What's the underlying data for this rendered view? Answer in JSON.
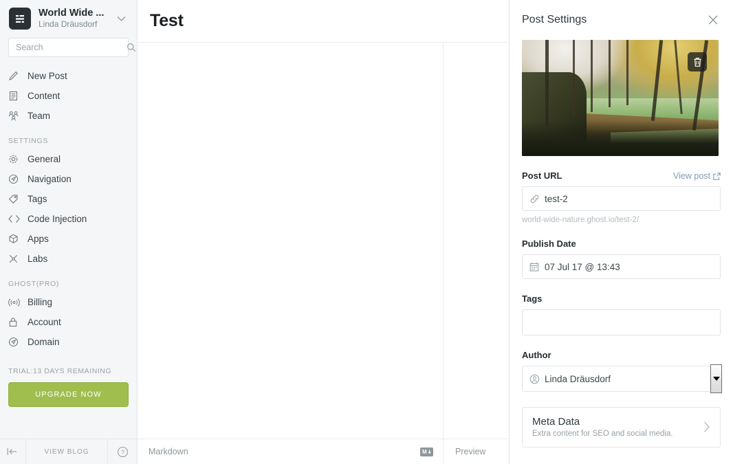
{
  "sidebar": {
    "brand": {
      "title": "World Wide ...",
      "subtitle": "Linda Dräusdorf",
      "logo_icon": "blog-list-icon",
      "caret_icon": "chevron-down-icon"
    },
    "search": {
      "placeholder": "Search",
      "value": "",
      "icon": "search-icon"
    },
    "primary_items": [
      {
        "label": "New Post",
        "icon": "pencil-icon"
      },
      {
        "label": "Content",
        "icon": "document-icon"
      },
      {
        "label": "Team",
        "icon": "people-icon"
      }
    ],
    "settings_heading": "SETTINGS",
    "settings_items": [
      {
        "label": "General",
        "icon": "gear-icon"
      },
      {
        "label": "Navigation",
        "icon": "compass-icon"
      },
      {
        "label": "Tags",
        "icon": "tag-icon"
      },
      {
        "label": "Code Injection",
        "icon": "code-icon"
      },
      {
        "label": "Apps",
        "icon": "box-icon"
      },
      {
        "label": "Labs",
        "icon": "labs-icon"
      }
    ],
    "ghostpro_heading": "GHOST(PRO)",
    "ghostpro_items": [
      {
        "label": "Billing",
        "icon": "broadcast-icon"
      },
      {
        "label": "Account",
        "icon": "lock-icon"
      },
      {
        "label": "Domain",
        "icon": "compass-icon"
      }
    ],
    "trial_text": "TRIAL:13 DAYS REMAINING",
    "upgrade_label": "UPGRADE NOW",
    "upgrade_color": "#9fbe4e",
    "footer": {
      "collapse_icon": "collapse-left-icon",
      "view_blog_label": "VIEW BLOG",
      "help_icon": "help-circle-icon"
    }
  },
  "editor": {
    "title": "Test",
    "markdown_label": "Markdown",
    "markdown_badge": "M",
    "preview_label": "Preview"
  },
  "panel": {
    "title": "Post Settings",
    "close_icon": "close-icon",
    "feature_image": {
      "alt": "Autumn swamp forest with green algae water",
      "delete_icon": "trash-icon"
    },
    "post_url": {
      "label": "Post URL",
      "view_post_label": "View post",
      "view_post_icon": "external-link-icon",
      "input_icon": "link-icon",
      "value": "test-2",
      "hint": "world-wide-nature.ghost.io/test-2/"
    },
    "publish_date": {
      "label": "Publish Date",
      "input_icon": "calendar-icon",
      "value": "07 Jul 17 @ 13:43"
    },
    "tags": {
      "label": "Tags",
      "value": "",
      "placeholder": ""
    },
    "author": {
      "label": "Author",
      "input_icon": "user-circle-icon",
      "value": "Linda Dräusdorf",
      "dropdown_icon": "triangle-down-icon"
    },
    "meta_data": {
      "title": "Meta Data",
      "subtitle": "Extra content for SEO and social media.",
      "chevron_icon": "chevron-right-icon"
    }
  }
}
